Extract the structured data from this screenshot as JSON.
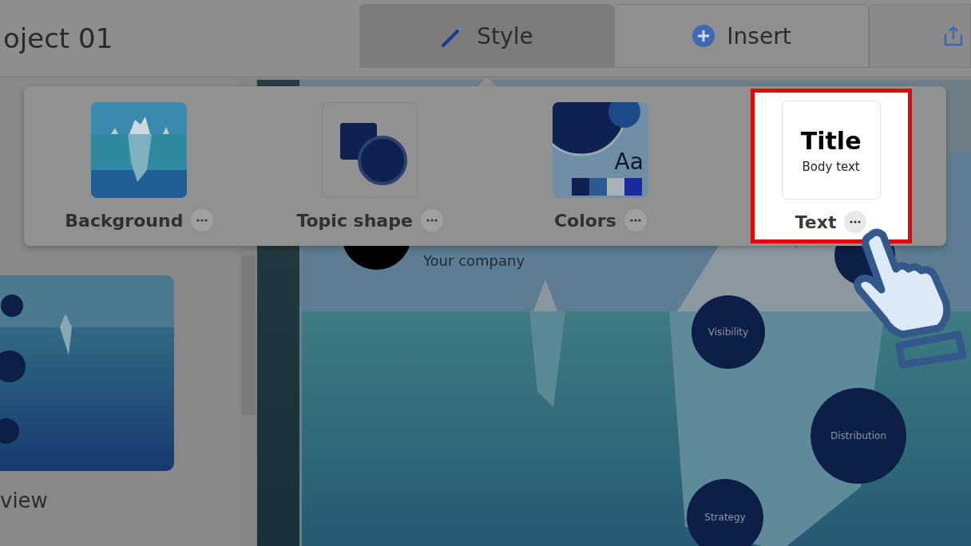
{
  "header": {
    "title": "oject 01"
  },
  "tabs": [
    {
      "label": "Style",
      "kind": "wand",
      "selected": true
    },
    {
      "label": "Insert",
      "kind": "plus",
      "selected": false
    }
  ],
  "style_menu": {
    "options": [
      {
        "label": "Background",
        "kind": "background",
        "highlighted": false
      },
      {
        "label": "Topic shape",
        "kind": "shape",
        "highlighted": false
      },
      {
        "label": "Colors",
        "kind": "colors",
        "preview_text": "Aa",
        "highlighted": false
      },
      {
        "label": "Text",
        "kind": "text",
        "preview_title": "Title",
        "preview_body": "Body text",
        "highlighted": true
      }
    ]
  },
  "sidebar": {
    "slide_label": "view"
  },
  "slide": {
    "subtitle": "Your company",
    "topics": [
      {
        "label": "Visibility"
      },
      {
        "label": "Distribution"
      },
      {
        "label": "Strategy"
      }
    ]
  }
}
